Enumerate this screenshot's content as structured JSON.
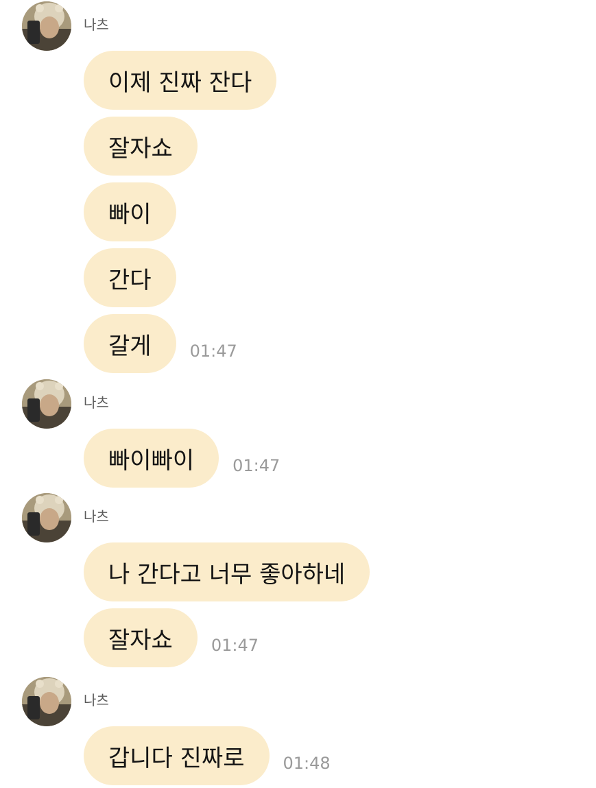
{
  "conversation": {
    "groups": [
      {
        "sender": "나츠",
        "messages": [
          "이제 진짜 잔다",
          "잘자쇼",
          "빠이",
          "간다",
          "갈게"
        ],
        "time": "01:47"
      },
      {
        "sender": "나츠",
        "messages": [
          "빠이빠이"
        ],
        "time": "01:47"
      },
      {
        "sender": "나츠",
        "messages": [
          "나 간다고 너무 좋아하네",
          "잘자쇼"
        ],
        "time": "01:47"
      },
      {
        "sender": "나츠",
        "messages": [
          "갑니다 진짜로"
        ],
        "time": "01:48"
      }
    ]
  },
  "colors": {
    "bubble": "#fbeccb",
    "bubble_text": "#141414",
    "timestamp": "#9a9a9a",
    "sender_name": "#5b5b5b",
    "background": "#ffffff"
  },
  "icons": {
    "avatar": "profile-photo-avatar-icon"
  }
}
